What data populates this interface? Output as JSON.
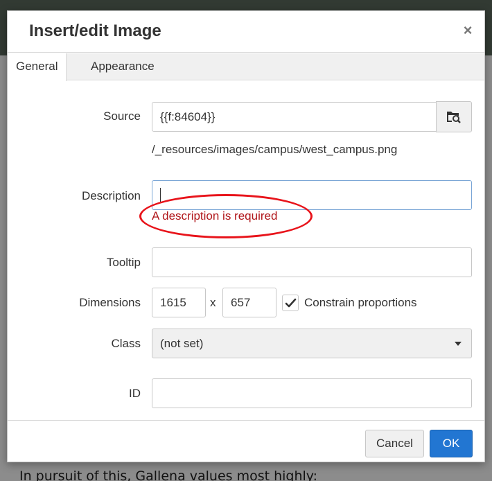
{
  "dialog": {
    "title": "Insert/edit Image",
    "close_symbol": "×"
  },
  "tabs": [
    {
      "label": "General",
      "active": true
    },
    {
      "label": "Appearance",
      "active": false
    }
  ],
  "form": {
    "source": {
      "label": "Source",
      "value": "{{f:84604}}",
      "resolved_path": "/_resources/images/campus/west_campus.png",
      "browse_icon": "folder-search-icon"
    },
    "description": {
      "label": "Description",
      "value": "",
      "error": "A description is required"
    },
    "tooltip": {
      "label": "Tooltip",
      "value": ""
    },
    "dimensions": {
      "label": "Dimensions",
      "width": "1615",
      "separator": "x",
      "height": "657",
      "constrain_label": "Constrain proportions",
      "constrain_checked": true
    },
    "class": {
      "label": "Class",
      "selected": "(not set)"
    },
    "id": {
      "label": "ID",
      "value": ""
    }
  },
  "footer": {
    "cancel_label": "Cancel",
    "ok_label": "OK"
  },
  "background": {
    "text": "In pursuit of this, Gallena values most highly:"
  },
  "colors": {
    "primary_button": "#2276d2",
    "error_text": "#b0171b",
    "annotation_ellipse": "#e8141b"
  }
}
